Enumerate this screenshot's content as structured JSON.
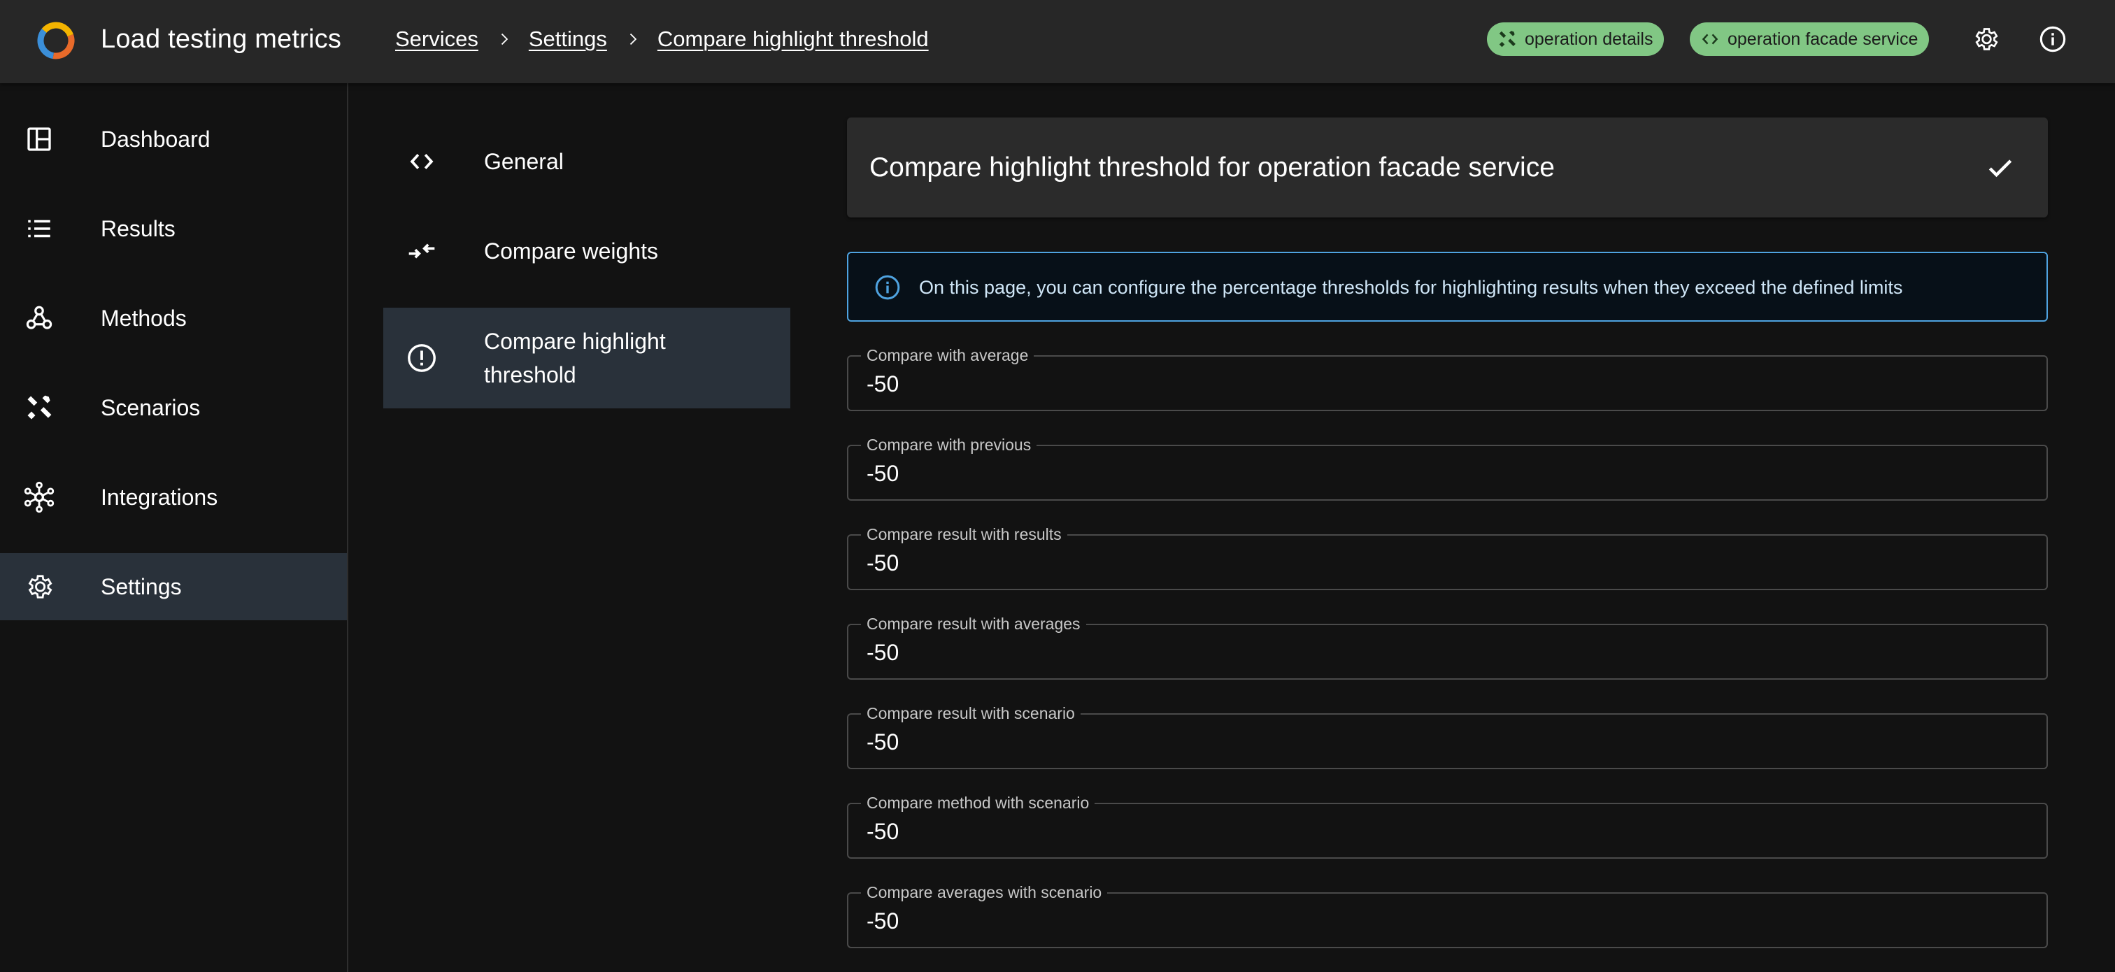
{
  "app": {
    "title": "Load testing metrics",
    "logo_icon": "app-logo-icon"
  },
  "breadcrumbs": [
    "Services",
    "Settings",
    "Compare highlight threshold"
  ],
  "chips": [
    {
      "label": "operation details",
      "icon": "tools-icon"
    },
    {
      "label": "operation facade service",
      "icon": "code-icon"
    }
  ],
  "top_icons": [
    "gear-icon",
    "info-icon"
  ],
  "sidebar": {
    "items": [
      {
        "label": "Dashboard",
        "icon": "dashboard-icon",
        "active": false
      },
      {
        "label": "Results",
        "icon": "list-icon",
        "active": false
      },
      {
        "label": "Methods",
        "icon": "webhook-icon",
        "active": false
      },
      {
        "label": "Scenarios",
        "icon": "tools-icon",
        "active": false
      },
      {
        "label": "Integrations",
        "icon": "hub-icon",
        "active": false
      },
      {
        "label": "Settings",
        "icon": "gear-icon",
        "active": true
      }
    ]
  },
  "subnav": {
    "items": [
      {
        "label": "General",
        "icon": "code-icon",
        "active": false
      },
      {
        "label": "Compare weights",
        "icon": "compare-arrows-icon",
        "active": false
      },
      {
        "label": "Compare highlight threshold",
        "icon": "alert-circle-icon",
        "active": true
      }
    ]
  },
  "main": {
    "title": "Compare highlight threshold for operation facade service",
    "save_icon": "check-icon",
    "info_text": "On this page, you can configure the percentage thresholds for highlighting results when they exceed the defined limits",
    "fields": [
      {
        "label": "Compare with average",
        "value": "-50"
      },
      {
        "label": "Compare with previous",
        "value": "-50"
      },
      {
        "label": "Compare result with results",
        "value": "-50"
      },
      {
        "label": "Compare result with averages",
        "value": "-50"
      },
      {
        "label": "Compare result with scenario",
        "value": "-50"
      },
      {
        "label": "Compare method with scenario",
        "value": "-50"
      },
      {
        "label": "Compare averages with scenario",
        "value": "-50"
      }
    ]
  },
  "colors": {
    "topbar": "#272727",
    "background": "#121212",
    "chip": "#81c784",
    "active_item": "#29313a",
    "info_border": "#4fa3e0"
  }
}
